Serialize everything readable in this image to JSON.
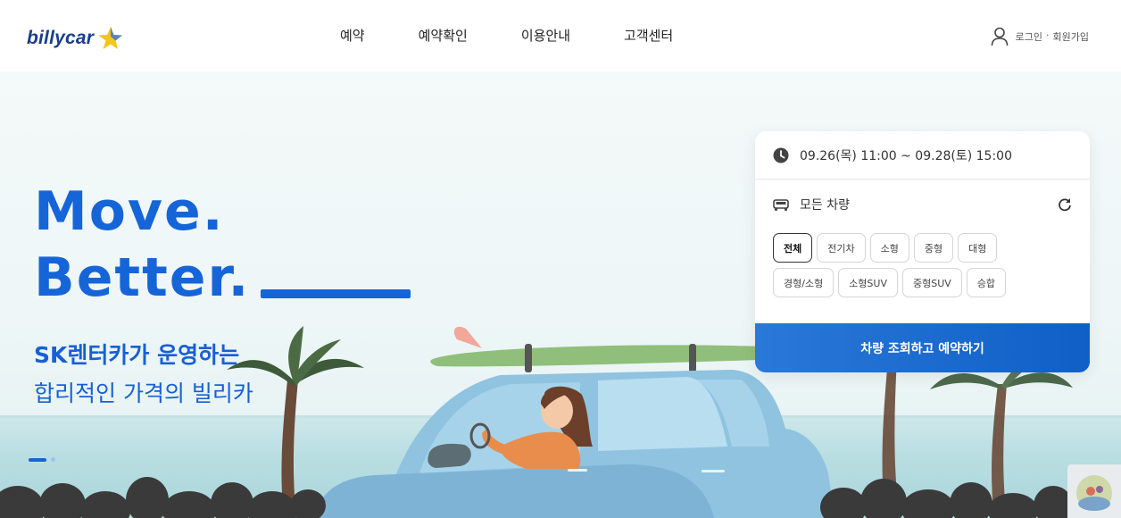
{
  "header": {
    "logo_text": "billycar",
    "nav": [
      "예약",
      "예약확인",
      "이용안내",
      "고객센터"
    ],
    "user": {
      "login": "로그인",
      "separator": "·",
      "signup": "회원가입"
    }
  },
  "hero": {
    "headline_line1": "Move.",
    "headline_line2": "Better.",
    "sub_line1": "SK렌터카가 운영하는",
    "sub_line2": "합리적인 가격의 빌리카"
  },
  "booking": {
    "date_range": "09.26(목) 11:00 ~ 09.28(토) 15:00",
    "vehicle_type_label": "모든 차량",
    "chips": [
      "전체",
      "전기차",
      "소형",
      "중형",
      "대형",
      "경형/소형",
      "소형SUV",
      "중형SUV",
      "승합"
    ],
    "selected_chip": "전체",
    "cta_label": "차량 조회하고 예약하기"
  },
  "colors": {
    "brand_blue": "#1565d8",
    "logo_navy": "#1a3e8c",
    "star_yellow": "#f5c518",
    "cta_blue": "#1b68cf"
  },
  "icons": [
    "star-icon",
    "user-icon",
    "clock-icon",
    "car-icon",
    "refresh-icon"
  ]
}
